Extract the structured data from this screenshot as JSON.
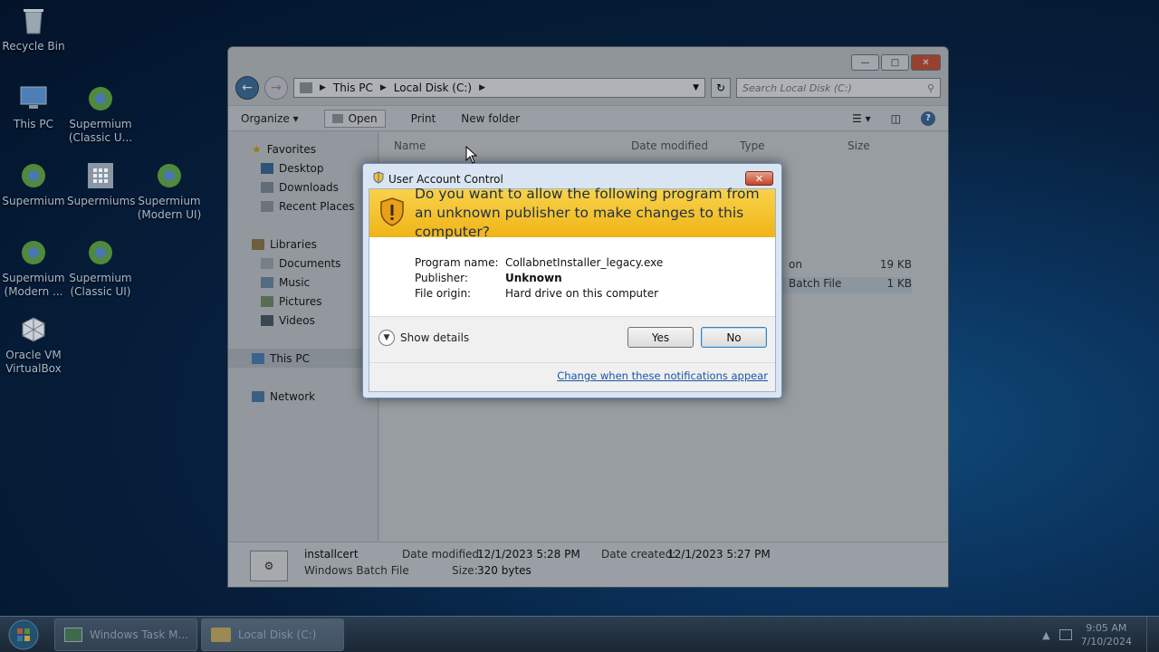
{
  "desktop": {
    "icons": [
      {
        "label": "Recycle Bin",
        "icon": "recycle-bin-icon"
      },
      {
        "label": "This PC",
        "icon": "computer-icon"
      },
      {
        "label": "Supermium (Classic U...",
        "icon": "supermium-icon"
      },
      {
        "label": "Supermium",
        "icon": "supermium-icon"
      },
      {
        "label": "Supermiums",
        "icon": "grid-icon"
      },
      {
        "label": "Supermium (Modern UI)",
        "icon": "supermium-icon"
      },
      {
        "label": "Supermium (Modern ...",
        "icon": "supermium-icon"
      },
      {
        "label": "Supermium (Classic UI)",
        "icon": "supermium-icon"
      },
      {
        "label": "Oracle VM VirtualBox",
        "icon": "virtualbox-icon"
      }
    ]
  },
  "explorer": {
    "breadcrumb": [
      "This PC",
      "Local Disk (C:)"
    ],
    "search_placeholder": "Search Local Disk (C:)",
    "toolbar": {
      "organize": "Organize",
      "open": "Open",
      "print": "Print",
      "new_folder": "New folder"
    },
    "nav": {
      "favorites": "Favorites",
      "desktop": "Desktop",
      "downloads": "Downloads",
      "recent": "Recent Places",
      "libraries": "Libraries",
      "documents": "Documents",
      "music": "Music",
      "pictures": "Pictures",
      "videos": "Videos",
      "this_pc": "This PC",
      "network": "Network"
    },
    "columns": {
      "name": "Name",
      "date": "Date modified",
      "type": "Type",
      "size": "Size"
    },
    "rows": [
      {
        "type": "on",
        "size": "19 KB"
      },
      {
        "type": "Batch File",
        "size": "1 KB"
      }
    ],
    "details": {
      "name": "installcert",
      "kind": "Windows Batch File",
      "date_modified_label": "Date modified:",
      "date_modified": "12/1/2023 5:28 PM",
      "date_created_label": "Date created:",
      "date_created": "12/1/2023 5:27 PM",
      "size_label": "Size:",
      "size": "320 bytes"
    }
  },
  "uac": {
    "title": "User Account Control",
    "question": "Do you want to allow the following program from an unknown publisher to make changes to this computer?",
    "program_label": "Program name:",
    "program_value": "CollabnetInstaller_legacy.exe",
    "publisher_label": "Publisher:",
    "publisher_value": "Unknown",
    "origin_label": "File origin:",
    "origin_value": "Hard drive on this computer",
    "show_details": "Show details",
    "yes": "Yes",
    "no": "No",
    "link": "Change when these notifications appear",
    "accent": "#f0b418"
  },
  "taskbar": {
    "buttons": [
      "Windows Task M...",
      "Local Disk (C:)"
    ],
    "time": "9:05 AM",
    "date": "7/10/2024"
  }
}
